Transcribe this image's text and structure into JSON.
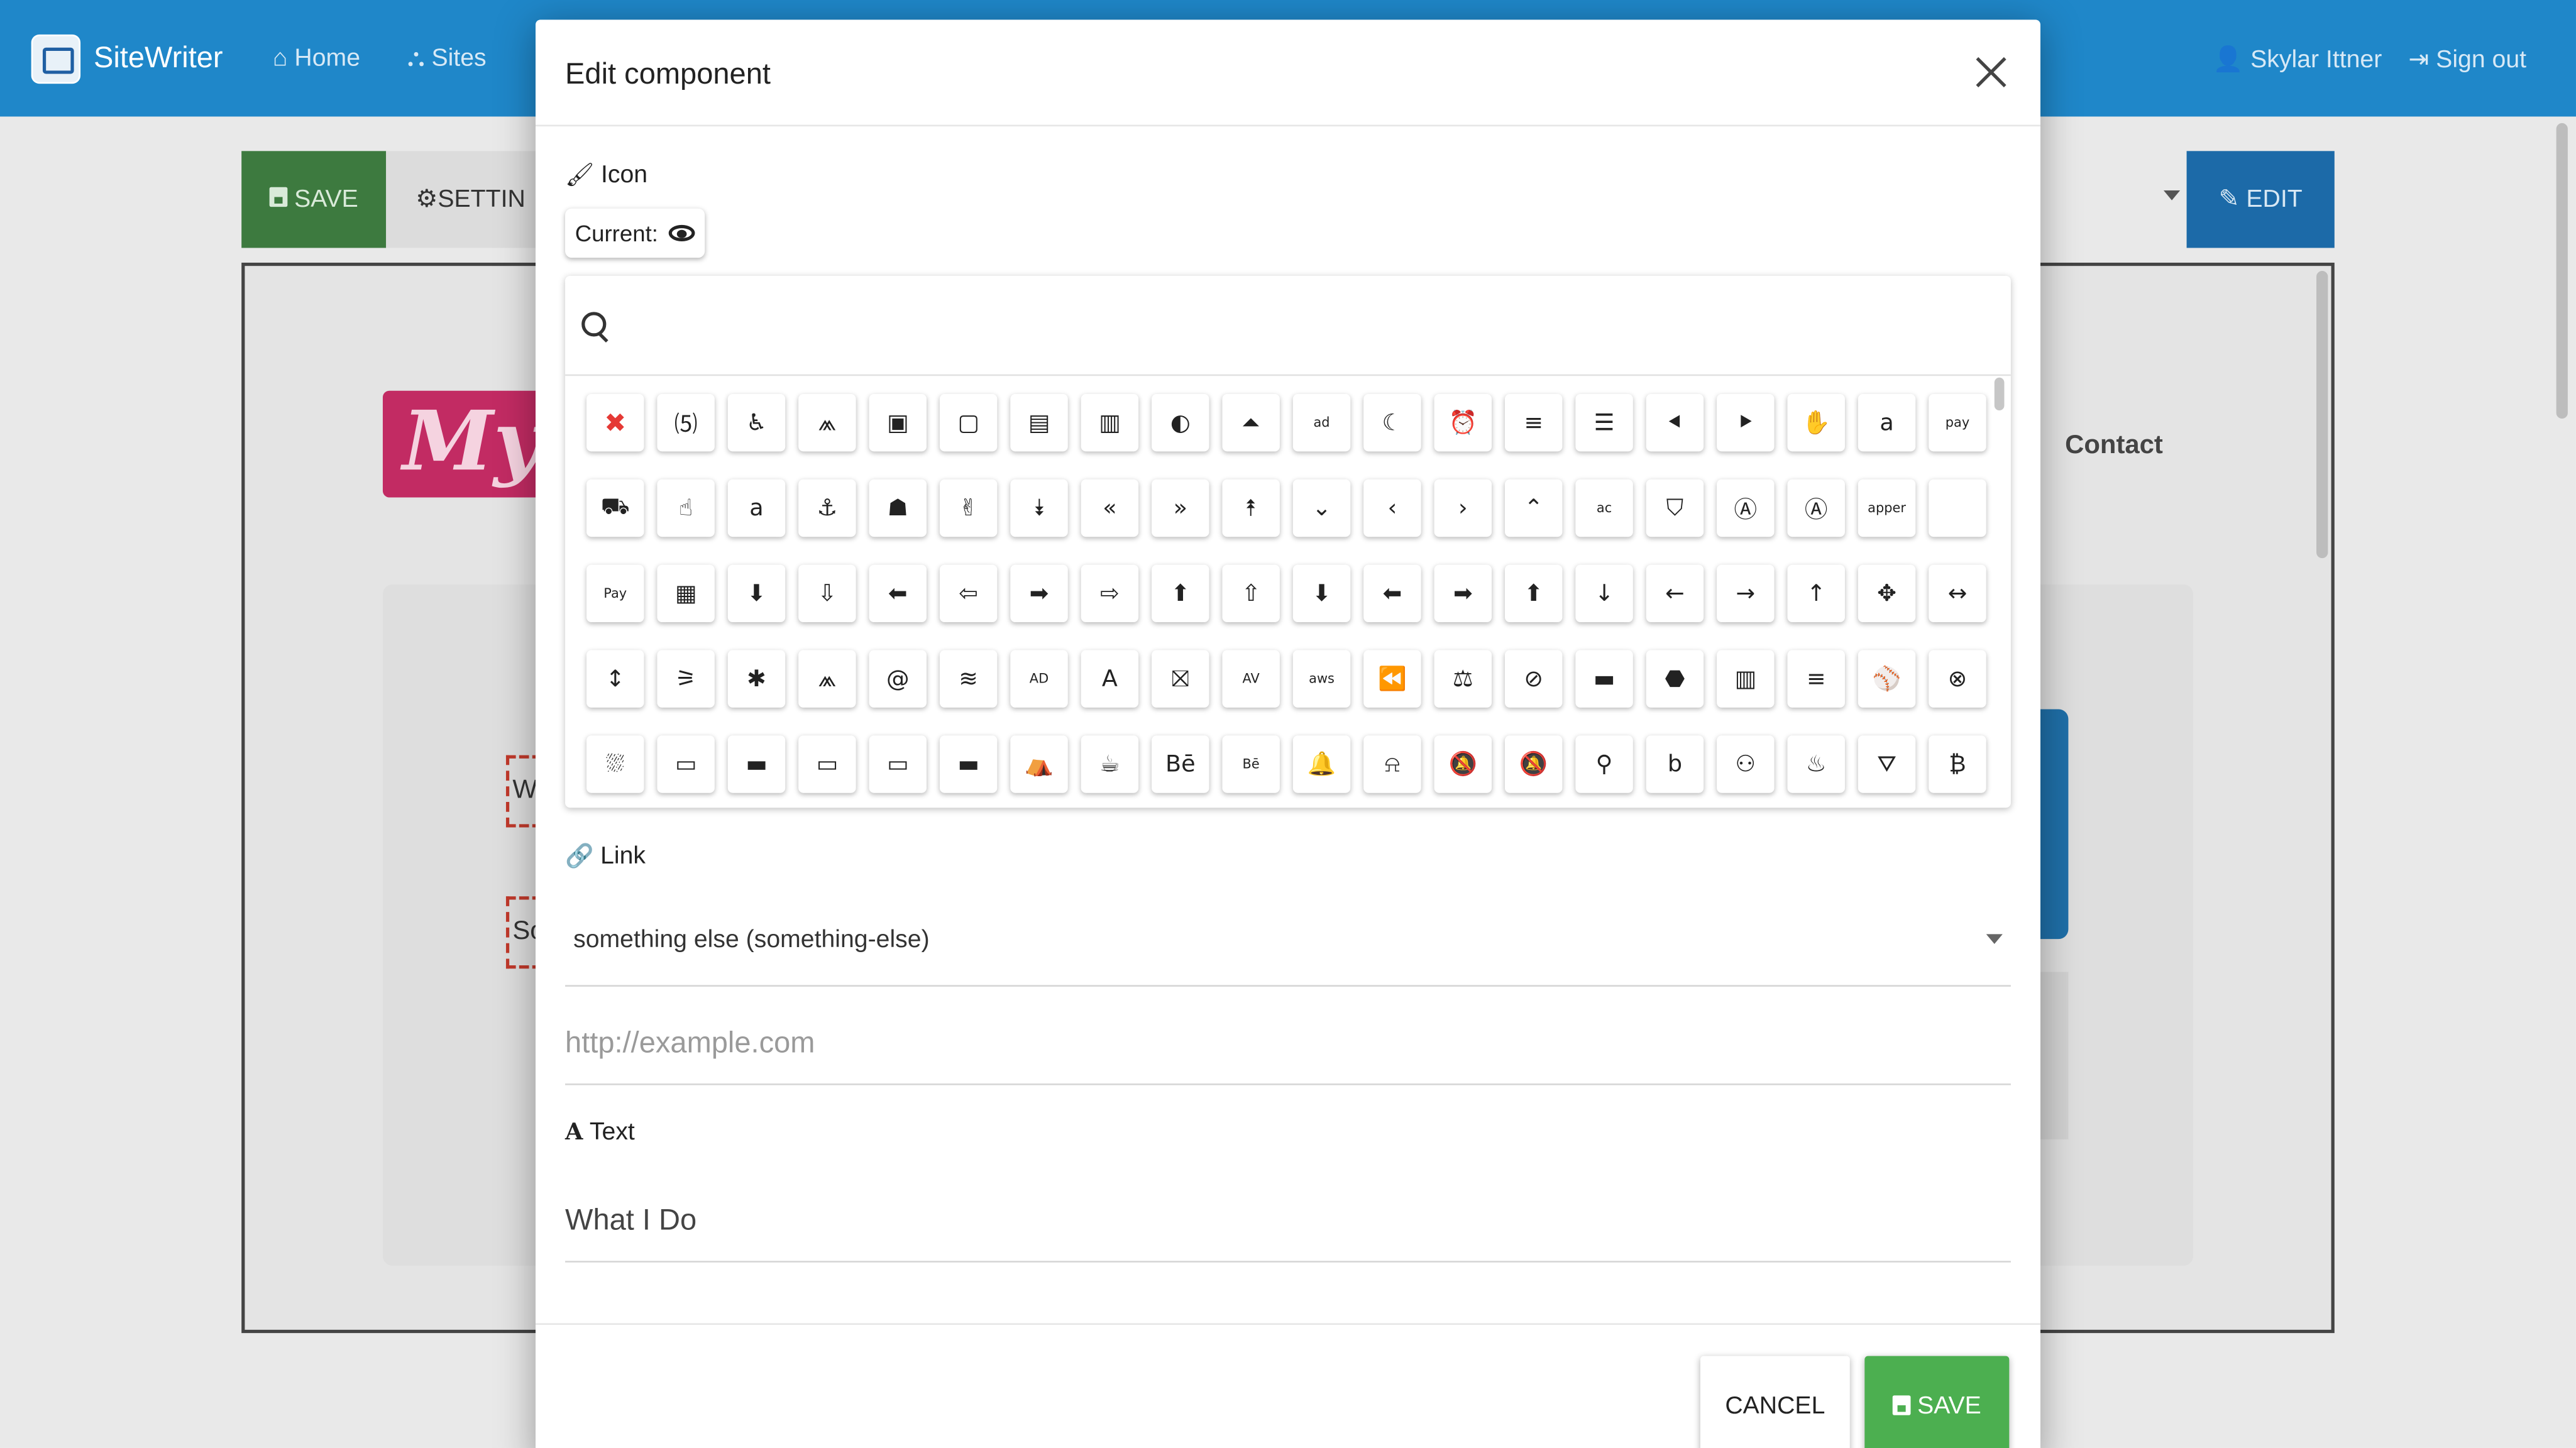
{
  "navbar": {
    "brand": "SiteWriter",
    "home": "Home",
    "sites": "Sites",
    "user": "Skylar Ittner",
    "signout": "Sign out",
    "color": "#1f87c9"
  },
  "toolbar": {
    "save_label": "SAVE",
    "settings_label": "SETTIN",
    "edit_label": "EDIT"
  },
  "preview": {
    "logo_text": "My",
    "contact_label": "Contact",
    "dashed_1": "W",
    "dashed_2": "So"
  },
  "modal": {
    "title": "Edit component",
    "icon_section": {
      "label": "Icon",
      "current_label": "Current:",
      "current_icon": "eye-icon",
      "search_placeholder": "",
      "icons": [
        {
          "name": "none-x-icon",
          "glyph": "✖",
          "style": "red"
        },
        {
          "name": "500px-icon",
          "glyph": "⑸"
        },
        {
          "name": "accessible-icon",
          "glyph": "♿"
        },
        {
          "name": "accusoft-icon",
          "glyph": "⩕"
        },
        {
          "name": "address-book-icon",
          "glyph": "▣"
        },
        {
          "name": "address-book-outline-icon",
          "glyph": "▢"
        },
        {
          "name": "address-card-icon",
          "glyph": "▤"
        },
        {
          "name": "address-card-outline-icon",
          "glyph": "▥"
        },
        {
          "name": "adjust-icon",
          "glyph": "◐"
        },
        {
          "name": "adn-icon",
          "glyph": "⏶"
        },
        {
          "name": "adversal-icon",
          "glyph": "ad",
          "style": "small"
        },
        {
          "name": "affiliatetheme-icon",
          "glyph": "☾"
        },
        {
          "name": "alarm-clock-icon",
          "glyph": "⏰"
        },
        {
          "name": "align-center-icon",
          "glyph": "≡"
        },
        {
          "name": "align-justify-icon",
          "glyph": "☰"
        },
        {
          "name": "align-left-icon",
          "glyph": "⯇"
        },
        {
          "name": "align-right-icon",
          "glyph": "⯈"
        },
        {
          "name": "allergies-icon",
          "glyph": "✋"
        },
        {
          "name": "amazon-icon",
          "glyph": "a"
        },
        {
          "name": "amazon-pay-icon",
          "glyph": "pay",
          "style": "small"
        },
        {
          "name": "ambulance-icon",
          "glyph": "⛟"
        },
        {
          "name": "american-sign-language-icon",
          "glyph": "☝"
        },
        {
          "name": "amilia-icon",
          "glyph": "a"
        },
        {
          "name": "anchor-icon",
          "glyph": "⚓"
        },
        {
          "name": "android-icon",
          "glyph": "☗"
        },
        {
          "name": "angellist-icon",
          "glyph": "✌"
        },
        {
          "name": "angle-double-down-icon",
          "glyph": "⯯"
        },
        {
          "name": "angle-double-left-icon",
          "glyph": "«"
        },
        {
          "name": "angle-double-right-icon",
          "glyph": "»"
        },
        {
          "name": "angle-double-up-icon",
          "glyph": "⯭"
        },
        {
          "name": "angle-down-icon",
          "glyph": "⌄"
        },
        {
          "name": "angle-left-icon",
          "glyph": "‹"
        },
        {
          "name": "angle-right-icon",
          "glyph": "›"
        },
        {
          "name": "angle-up-icon",
          "glyph": "⌃"
        },
        {
          "name": "angrycreative-icon",
          "glyph": "ac",
          "style": "small"
        },
        {
          "name": "angular-icon",
          "glyph": "⛉"
        },
        {
          "name": "app-store-icon",
          "glyph": "Ⓐ"
        },
        {
          "name": "app-store-ios-icon",
          "glyph": "Ⓐ"
        },
        {
          "name": "apper-icon",
          "glyph": "apper",
          "style": "small"
        },
        {
          "name": "apple-icon",
          "glyph": ""
        },
        {
          "name": "apple-pay-icon",
          "glyph": "Pay",
          "style": "small"
        },
        {
          "name": "archive-icon",
          "glyph": "▦"
        },
        {
          "name": "arrow-alt-circle-down-icon",
          "glyph": "⬇"
        },
        {
          "name": "arrow-alt-circle-down-outline-icon",
          "glyph": "⇩"
        },
        {
          "name": "arrow-alt-circle-left-icon",
          "glyph": "⬅"
        },
        {
          "name": "arrow-alt-circle-left-outline-icon",
          "glyph": "⇦"
        },
        {
          "name": "arrow-alt-circle-right-icon",
          "glyph": "➡"
        },
        {
          "name": "arrow-alt-circle-right-outline-icon",
          "glyph": "⇨"
        },
        {
          "name": "arrow-alt-circle-up-icon",
          "glyph": "⬆"
        },
        {
          "name": "arrow-alt-circle-up-outline-icon",
          "glyph": "⇧"
        },
        {
          "name": "arrow-circle-down-icon",
          "glyph": "⬇"
        },
        {
          "name": "arrow-circle-left-icon",
          "glyph": "⬅"
        },
        {
          "name": "arrow-circle-right-icon",
          "glyph": "➡"
        },
        {
          "name": "arrow-circle-up-icon",
          "glyph": "⬆"
        },
        {
          "name": "arrow-down-icon",
          "glyph": "↓"
        },
        {
          "name": "arrow-left-icon",
          "glyph": "←"
        },
        {
          "name": "arrow-right-icon",
          "glyph": "→"
        },
        {
          "name": "arrow-up-icon",
          "glyph": "↑"
        },
        {
          "name": "arrows-alt-icon",
          "glyph": "✥"
        },
        {
          "name": "arrows-alt-h-icon",
          "glyph": "↔"
        },
        {
          "name": "arrows-alt-v-icon",
          "glyph": "↕"
        },
        {
          "name": "assistive-listening-icon",
          "glyph": "⚞"
        },
        {
          "name": "asterisk-icon",
          "glyph": "✱"
        },
        {
          "name": "asymmetrik-icon",
          "glyph": "⩕"
        },
        {
          "name": "at-icon",
          "glyph": "@"
        },
        {
          "name": "audible-icon",
          "glyph": "≋"
        },
        {
          "name": "audio-description-icon",
          "glyph": "AD",
          "style": "small"
        },
        {
          "name": "autoprefixer-icon",
          "glyph": "A"
        },
        {
          "name": "avianex-icon",
          "glyph": "⛝"
        },
        {
          "name": "aviato-icon",
          "glyph": "AV",
          "style": "small"
        },
        {
          "name": "aws-icon",
          "glyph": "aws",
          "style": "small"
        },
        {
          "name": "backward-icon",
          "glyph": "⏪"
        },
        {
          "name": "balance-scale-icon",
          "glyph": "⚖"
        },
        {
          "name": "ban-icon",
          "glyph": "⊘"
        },
        {
          "name": "band-aid-icon",
          "glyph": "▬"
        },
        {
          "name": "bandcamp-icon",
          "glyph": "⬣"
        },
        {
          "name": "barcode-icon",
          "glyph": "▥"
        },
        {
          "name": "bars-icon",
          "glyph": "≡"
        },
        {
          "name": "baseball-ball-icon",
          "glyph": "⚾"
        },
        {
          "name": "basketball-ball-icon",
          "glyph": "⊗"
        },
        {
          "name": "bath-icon",
          "glyph": "⛆"
        },
        {
          "name": "battery-empty-icon",
          "glyph": "▭"
        },
        {
          "name": "battery-full-icon",
          "glyph": "▬"
        },
        {
          "name": "battery-half-icon",
          "glyph": "▭"
        },
        {
          "name": "battery-quarter-icon",
          "glyph": "▭"
        },
        {
          "name": "battery-three-quarters-icon",
          "glyph": "▬"
        },
        {
          "name": "bed-icon",
          "glyph": "⛺"
        },
        {
          "name": "beer-icon",
          "glyph": "☕"
        },
        {
          "name": "behance-icon",
          "glyph": "Bē"
        },
        {
          "name": "behance-square-icon",
          "glyph": "Bē",
          "style": "small"
        },
        {
          "name": "bell-icon",
          "glyph": "🔔"
        },
        {
          "name": "bell-outline-icon",
          "glyph": "⍾"
        },
        {
          "name": "bell-slash-icon",
          "glyph": "🔕"
        },
        {
          "name": "bell-slash-outline-icon",
          "glyph": "🔕"
        },
        {
          "name": "bicycle-icon",
          "glyph": "⚲"
        },
        {
          "name": "bimobject-icon",
          "glyph": "b"
        },
        {
          "name": "binoculars-icon",
          "glyph": "⚇"
        },
        {
          "name": "birthday-cake-icon",
          "glyph": "♨"
        },
        {
          "name": "bitbucket-icon",
          "glyph": "⛛"
        },
        {
          "name": "bitcoin-icon",
          "glyph": "₿"
        }
      ]
    },
    "link_section": {
      "label": "Link",
      "selected": "something else (something-else)",
      "url_placeholder": "http://example.com",
      "url_value": ""
    },
    "text_section": {
      "label": "Text",
      "value": "What I Do"
    },
    "footer": {
      "cancel_label": "CANCEL",
      "save_label": "SAVE",
      "save_color": "#4caf50"
    }
  }
}
